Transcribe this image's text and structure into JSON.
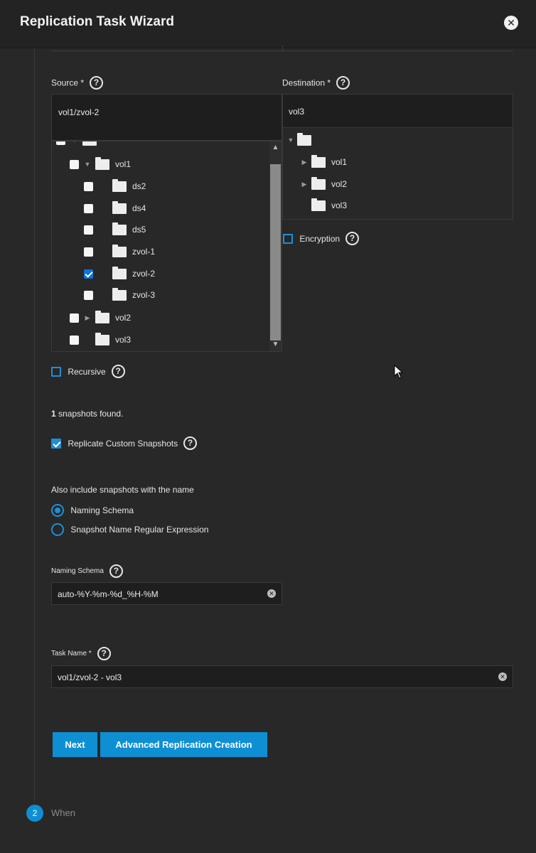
{
  "header": {
    "title": "Replication Task Wizard",
    "close_icon": "close-icon"
  },
  "source": {
    "label": "Source *",
    "value": "vol1/zvol-2",
    "tree": [
      {
        "name": "vol1",
        "checked": false,
        "expanded": true,
        "level": 1
      },
      {
        "name": "ds2",
        "checked": false,
        "level": 2
      },
      {
        "name": "ds4",
        "checked": false,
        "level": 2
      },
      {
        "name": "ds5",
        "checked": false,
        "level": 2
      },
      {
        "name": "zvol-1",
        "checked": false,
        "level": 2
      },
      {
        "name": "zvol-2",
        "checked": true,
        "level": 2
      },
      {
        "name": "zvol-3",
        "checked": false,
        "level": 2
      },
      {
        "name": "vol2",
        "checked": false,
        "expanded": false,
        "level": 1
      },
      {
        "name": "vol3",
        "checked": false,
        "level": 1
      }
    ]
  },
  "destination": {
    "label": "Destination *",
    "value": "vol3",
    "tree": [
      {
        "name": "vol1",
        "level": 1,
        "has_children": true
      },
      {
        "name": "vol2",
        "level": 1,
        "has_children": true
      },
      {
        "name": "vol3",
        "level": 1,
        "has_children": false
      }
    ],
    "encryption_label": "Encryption",
    "encryption_checked": false
  },
  "recursive": {
    "label": "Recursive",
    "checked": false
  },
  "snapshots_found": {
    "count": "1",
    "text": "snapshots found."
  },
  "replicate_custom": {
    "label": "Replicate Custom Snapshots",
    "checked": true
  },
  "include_names": {
    "label": "Also include snapshots with the name",
    "options": [
      "Naming Schema",
      "Snapshot Name Regular Expression"
    ],
    "selected": "Naming Schema"
  },
  "naming_schema": {
    "label": "Naming Schema",
    "value": "auto-%Y-%m-%d_%H-%M"
  },
  "task_name": {
    "label": "Task Name *",
    "value": "vol1/zvol-2 - vol3"
  },
  "buttons": {
    "next": "Next",
    "advanced": "Advanced Replication Creation"
  },
  "steps": {
    "next_step_number": "2",
    "next_step_label": "When"
  },
  "colors": {
    "accent": "#0e8fd3",
    "background": "#282828",
    "input_bg": "#1e1e1e"
  }
}
